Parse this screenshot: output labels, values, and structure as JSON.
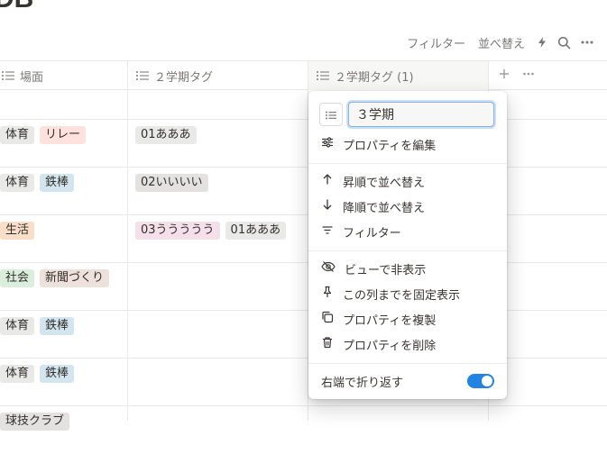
{
  "page": {
    "title": "DB"
  },
  "toolbar": {
    "filter_label": "フィルター",
    "sort_label": "並べ替え",
    "automation_icon": "lightning-icon",
    "search_icon": "search-icon",
    "more_icon": "more-icon"
  },
  "columns": [
    {
      "label": "場面",
      "icon": "list-property-icon"
    },
    {
      "label": "２学期タグ",
      "icon": "list-property-icon"
    },
    {
      "label": "２学期タグ (1)",
      "icon": "list-property-icon"
    }
  ],
  "rows": [
    {
      "scene": [],
      "term2": []
    },
    {
      "scene": [
        {
          "text": "体育",
          "color": "gray"
        },
        {
          "text": "リレー",
          "color": "red"
        }
      ],
      "term2": [
        {
          "text": "01あああ",
          "color": "gray"
        }
      ]
    },
    {
      "scene": [
        {
          "text": "体育",
          "color": "gray"
        },
        {
          "text": "鉄棒",
          "color": "blue"
        }
      ],
      "term2": [
        {
          "text": "02いいいい",
          "color": "gray2"
        }
      ]
    },
    {
      "scene": [
        {
          "text": "生活",
          "color": "orange"
        }
      ],
      "term2": [
        {
          "text": "03ううううう",
          "color": "pink"
        },
        {
          "text": "01あああ",
          "color": "gray"
        }
      ]
    },
    {
      "scene": [
        {
          "text": "社会",
          "color": "green"
        },
        {
          "text": "新聞づくり",
          "color": "brown"
        }
      ],
      "term2": []
    },
    {
      "scene": [
        {
          "text": "体育",
          "color": "gray"
        },
        {
          "text": "鉄棒",
          "color": "blue"
        }
      ],
      "term2": []
    },
    {
      "scene": [
        {
          "text": "体育",
          "color": "gray"
        },
        {
          "text": "鉄棒",
          "color": "blue"
        }
      ],
      "term2": []
    },
    {
      "scene": [
        {
          "text": "球技クラブ",
          "color": "gray2"
        }
      ],
      "term2": []
    }
  ],
  "menu": {
    "name_value": "３学期",
    "edit_property": "プロパティを編集",
    "sort_asc": "昇順で並べ替え",
    "sort_desc": "降順で並べ替え",
    "filter": "フィルター",
    "hide_in_view": "ビューで非表示",
    "freeze_up_to": "この列までを固定表示",
    "duplicate_property": "プロパティを複製",
    "delete_property": "プロパティを削除",
    "wrap_label": "右端で折り返す",
    "wrap_enabled": true
  },
  "colors": {
    "accent": "#2383e2",
    "text": "#37352f",
    "muted": "#787774"
  }
}
